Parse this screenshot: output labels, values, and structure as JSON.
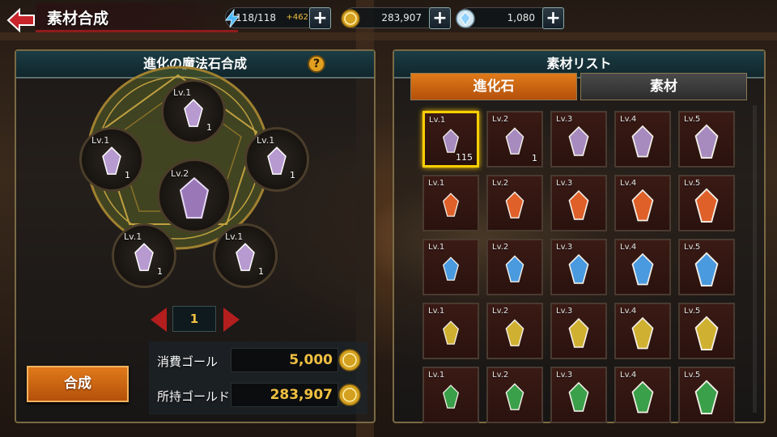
{
  "header": {
    "title": "素材合成",
    "back_icon": "back-arrow-icon",
    "stamina": {
      "value": "118/118",
      "bonus": "+462",
      "icon": "lightning-icon"
    },
    "gold": {
      "value": "283,907",
      "icon": "gold-coin-icon"
    },
    "gems": {
      "value": "1,080",
      "icon": "crystal-icon"
    }
  },
  "left_panel": {
    "title": "進化の魔法石合成",
    "help_label": "?",
    "slots": [
      {
        "level": "Lv.1",
        "count": "1"
      },
      {
        "level": "Lv.1",
        "count": "1"
      },
      {
        "level": "Lv.1",
        "count": "1"
      },
      {
        "level": "Lv.2",
        "count": ""
      },
      {
        "level": "Lv.1",
        "count": "1"
      },
      {
        "level": "Lv.1",
        "count": "1"
      }
    ],
    "quantity": "1",
    "cost_label": "消費ゴール",
    "cost_value": "5,000",
    "owned_label": "所持ゴールド",
    "owned_value": "283,907",
    "synth_button": "合成"
  },
  "right_panel": {
    "title": "素材リスト",
    "tabs": [
      "進化石",
      "素材"
    ],
    "active_tab": 0,
    "rows": [
      {
        "color": "#a78bbf",
        "cells": [
          {
            "level": "Lv.1",
            "count": "115",
            "selected": true
          },
          {
            "level": "Lv.2",
            "count": "1"
          },
          {
            "level": "Lv.3",
            "count": ""
          },
          {
            "level": "Lv.4",
            "count": ""
          },
          {
            "level": "Lv.5",
            "count": ""
          }
        ]
      },
      {
        "color": "#e0602a",
        "cells": [
          {
            "level": "Lv.1",
            "count": ""
          },
          {
            "level": "Lv.2",
            "count": ""
          },
          {
            "level": "Lv.3",
            "count": ""
          },
          {
            "level": "Lv.4",
            "count": ""
          },
          {
            "level": "Lv.5",
            "count": ""
          }
        ]
      },
      {
        "color": "#4a9ae0",
        "cells": [
          {
            "level": "Lv.1",
            "count": ""
          },
          {
            "level": "Lv.2",
            "count": ""
          },
          {
            "level": "Lv.3",
            "count": ""
          },
          {
            "level": "Lv.4",
            "count": ""
          },
          {
            "level": "Lv.5",
            "count": ""
          }
        ]
      },
      {
        "color": "#d0b030",
        "cells": [
          {
            "level": "Lv.1",
            "count": ""
          },
          {
            "level": "Lv.2",
            "count": ""
          },
          {
            "level": "Lv.3",
            "count": ""
          },
          {
            "level": "Lv.4",
            "count": ""
          },
          {
            "level": "Lv.5",
            "count": ""
          }
        ]
      },
      {
        "color": "#3aa04a",
        "cells": [
          {
            "level": "Lv.1",
            "count": ""
          },
          {
            "level": "Lv.2",
            "count": ""
          },
          {
            "level": "Lv.3",
            "count": ""
          },
          {
            "level": "Lv.4",
            "count": ""
          },
          {
            "level": "Lv.5",
            "count": ""
          }
        ]
      }
    ]
  }
}
